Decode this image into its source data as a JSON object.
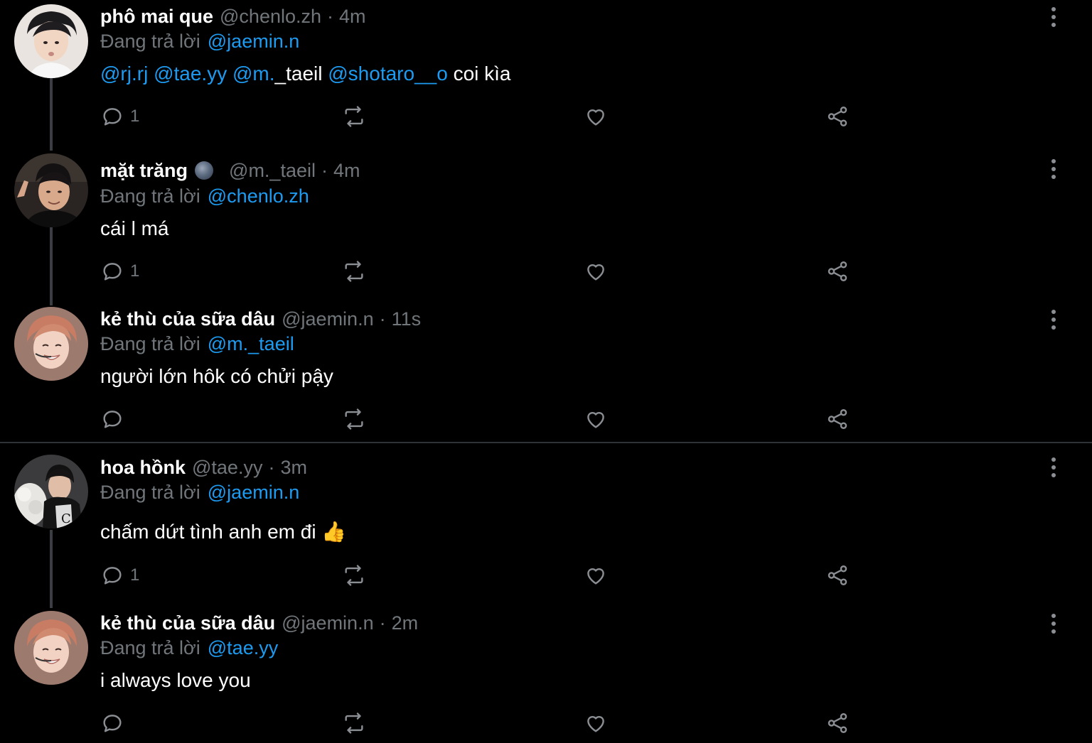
{
  "tweets": [
    {
      "name": "phô mai que",
      "handle": "@chenlo.zh",
      "time": "4m",
      "replying_label": "Đang trả lời",
      "replying_to": "@jaemin.n",
      "body": [
        {
          "text": "@rj.rj",
          "mention": true
        },
        {
          "text": " ",
          "mention": false
        },
        {
          "text": "@tae.yy",
          "mention": true
        },
        {
          "text": " ",
          "mention": false
        },
        {
          "text": "@m.",
          "mention": true
        },
        {
          "text": "_taeil ",
          "mention": false
        },
        {
          "text": "@shotaro__o",
          "mention": true
        },
        {
          "text": " coi kìa",
          "mention": false
        }
      ],
      "reply_count": "1"
    },
    {
      "name": "mặt trăng",
      "handle": "@m._taeil",
      "time": "4m",
      "replying_label": "Đang trả lời",
      "replying_to": "@chenlo.zh",
      "body": [
        {
          "text": "cái l má",
          "mention": false
        }
      ],
      "reply_count": "1"
    },
    {
      "name": "kẻ thù của sữa dâu",
      "handle": "@jaemin.n",
      "time": "11s",
      "replying_label": "Đang trả lời",
      "replying_to": "@m._taeil",
      "body": [
        {
          "text": "người lớn hôk có chửi pậy",
          "mention": false
        }
      ],
      "reply_count": ""
    },
    {
      "name": "hoa hồnk",
      "handle": "@tae.yy",
      "time": "3m",
      "replying_label": "Đang trả lời",
      "replying_to": "@jaemin.n",
      "body": [
        {
          "text": "chấm dứt tình anh em đi 👍",
          "mention": false
        }
      ],
      "reply_count": "1"
    },
    {
      "name": "kẻ thù của sữa dâu",
      "handle": "@jaemin.n",
      "time": "2m",
      "replying_label": "Đang trả lời",
      "replying_to": "@tae.yy",
      "body": [
        {
          "text": "i always love you",
          "mention": false
        }
      ],
      "reply_count": ""
    }
  ],
  "separator": "·",
  "icons": {
    "reply": "reply-icon",
    "retweet": "retweet-icon",
    "like": "heart-icon",
    "share": "share-icon",
    "more": "more-vertical-icon",
    "moon_emoji": "moon-emoji-icon"
  },
  "colors": {
    "background": "#000000",
    "mention": "#1d9bf0",
    "secondary_text": "#71767b",
    "primary_text": "#ffffff"
  }
}
